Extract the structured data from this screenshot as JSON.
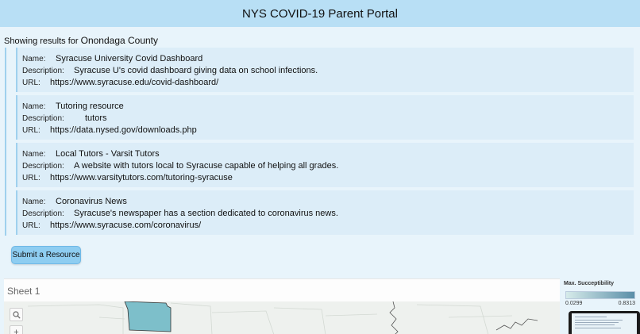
{
  "header": {
    "title": "NYS COVID-19 Parent Portal"
  },
  "results": {
    "prefix": "Showing results for",
    "county": "Onondaga County"
  },
  "labels": {
    "name": "Name:",
    "description": "Description:",
    "url": "URL:"
  },
  "resources": [
    {
      "name": "Syracuse University Covid Dashboard",
      "description": "Syracuse U's covid dashboard giving data on school infections.",
      "url": "https://www.syracuse.edu/covid-dashboard/"
    },
    {
      "name": "Tutoring resource",
      "description": "tutors",
      "url": "https://data.nysed.gov/downloads.php"
    },
    {
      "name": "Local Tutors - Varsit Tutors",
      "description": "A website with tutors local to Syracuse capable of helping all grades.",
      "url": "https://www.varsitytutors.com/tutoring-syracuse"
    },
    {
      "name": "Coronavirus News",
      "description": "Syracuse's newspaper has a section dedicated to coronavirus news.",
      "url": "https://www.syracuse.com/coronavirus/"
    }
  ],
  "submit": {
    "label": "Submit a Resource"
  },
  "sheet": {
    "title": "Sheet 1",
    "zoom_in": "+",
    "map_county_color": "#7dbfca"
  },
  "legend": {
    "title": "Max. Succeptibility",
    "min": "0.0299",
    "max": "0.8313"
  },
  "colors": {
    "header_bg": "#b8dff5",
    "page_bg": "#e8f4fb",
    "card_bg": "#dcedf8",
    "accent": "#8ecdf1"
  }
}
